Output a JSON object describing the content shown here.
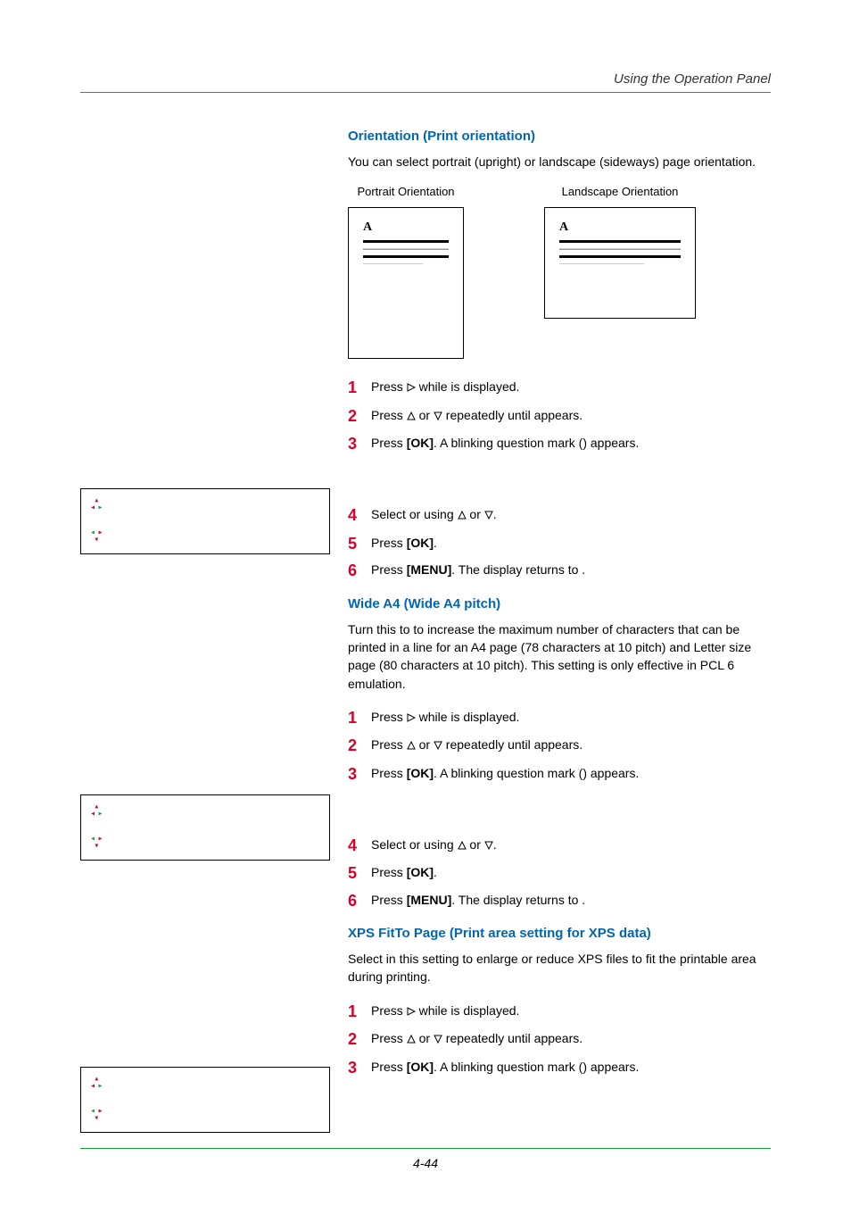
{
  "header": {
    "title": "Using the Operation Panel"
  },
  "sec1": {
    "heading": "Orientation (Print orientation)",
    "intro": "You can select portrait (upright) or landscape (sideways) page orientation.",
    "portrait_label": "Portrait Orientation",
    "landscape_label": "Landscape Orientation",
    "a": "A",
    "steps": {
      "s1a": "Press ",
      "s1b": " while ",
      "s1c": " is displayed.",
      "s2a": "Press ",
      "s2b": " or ",
      "s2c": " repeatedly until ",
      "s2d": " appears.",
      "s3a": "Press ",
      "s3ok": "[OK]",
      "s3b": ". A blinking question mark (",
      "s3c": ") appears.",
      "s4a": "Select ",
      "s4b": " or ",
      "s4c": " using ",
      "s4d": " or ",
      "s4e": ".",
      "s5a": "Press ",
      "s5ok": "[OK]",
      "s5b": ".",
      "s6a": "Press ",
      "s6menu": "[MENU]",
      "s6b": ". The display returns to ",
      "s6c": "."
    }
  },
  "sec2": {
    "heading": "Wide A4 (Wide A4 pitch)",
    "intro": "Turn this to      to increase the maximum number of characters that can be printed in a line for an A4 page (78 characters at 10 pitch) and Letter size page (80 characters at 10 pitch). This setting is only effective in PCL 6 emulation.",
    "steps": {
      "s1a": "Press ",
      "s1b": " while ",
      "s1c": " is displayed.",
      "s2a": "Press ",
      "s2b": " or ",
      "s2c": " repeatedly until ",
      "s2d": " appears.",
      "s3a": "Press ",
      "s3ok": "[OK]",
      "s3b": ". A blinking question mark (",
      "s3c": ") appears.",
      "s4a": "Select ",
      "s4b": " or ",
      "s4c": " using ",
      "s4d": " or ",
      "s4e": ".",
      "s5a": "Press ",
      "s5ok": "[OK]",
      "s5b": ".",
      "s6a": "Press ",
      "s6menu": "[MENU]",
      "s6b": ". The display returns to ",
      "s6c": "."
    }
  },
  "sec3": {
    "heading": "XPS FitTo Page (Print area setting for XPS data)",
    "intro": "Select       in this setting to enlarge or reduce XPS files to fit the printable area during printing.",
    "steps": {
      "s1a": "Press ",
      "s1b": " while ",
      "s1c": " is displayed.",
      "s2a": "Press ",
      "s2b": " or ",
      "s2c": " repeatedly until ",
      "s2d": " appears.",
      "s3a": "Press ",
      "s3ok": "[OK]",
      "s3b": ". A blinking question mark (",
      "s3c": ") appears."
    }
  },
  "footer": {
    "page": "4-44"
  }
}
